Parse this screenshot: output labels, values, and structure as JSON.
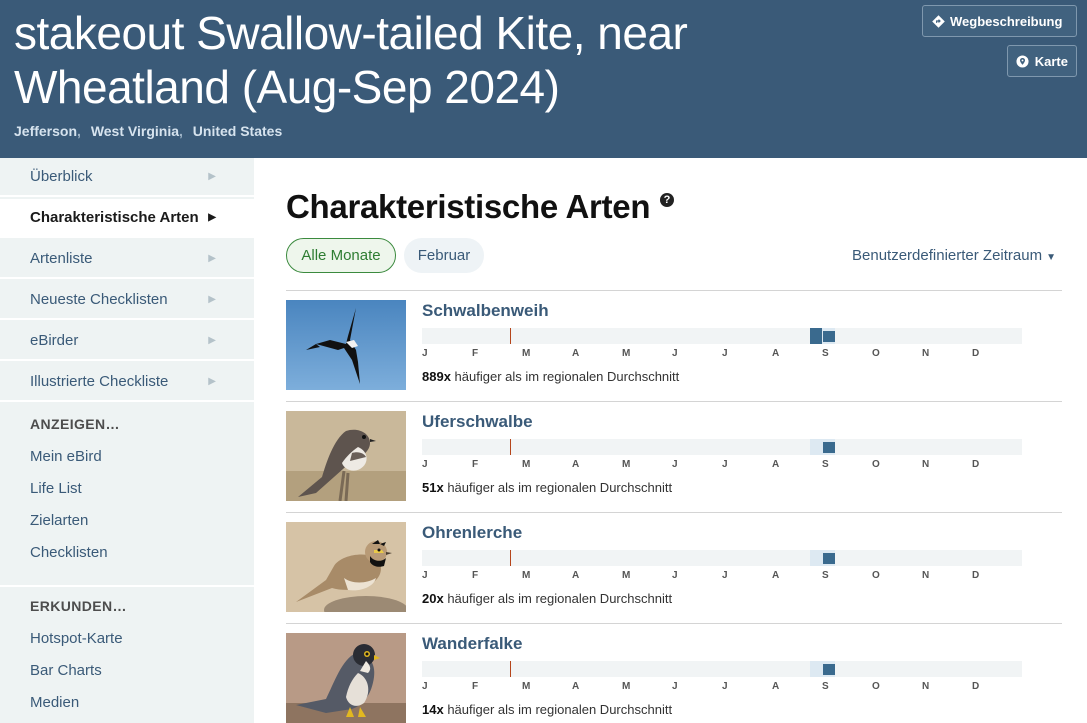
{
  "header": {
    "title_line1": "stakeout Swallow-tailed Kite, near",
    "title_line2": "Wheatland (Aug-Sep 2024)",
    "location": [
      "Jefferson",
      "West Virginia",
      "United States"
    ],
    "directions_label": "Wegbeschreibung",
    "map_label": "Karte"
  },
  "sidebar": {
    "items": [
      {
        "label": "Überblick",
        "active": false
      },
      {
        "label": "Charakteristische Arten",
        "active": true
      },
      {
        "label": "Artenliste",
        "active": false
      },
      {
        "label": "Neueste Checklisten",
        "active": false
      },
      {
        "label": "eBirder",
        "active": false
      },
      {
        "label": "Illustrierte Checkliste",
        "active": false
      }
    ],
    "view_heading": "ANZEIGEN…",
    "view_links": [
      "Mein eBird",
      "Life List",
      "Zielarten",
      "Checklisten"
    ],
    "explore_heading": "ERKUNDEN…",
    "explore_links": [
      "Hotspot-Karte",
      "Bar Charts",
      "Medien"
    ]
  },
  "main": {
    "title": "Charakteristische Arten",
    "help_glyph": "?",
    "filters": {
      "all_months": "Alle Monate",
      "february": "Februar"
    },
    "custom_range": "Benutzerdefinierter Zeitraum",
    "months": [
      "J",
      "F",
      "M",
      "A",
      "M",
      "J",
      "J",
      "A",
      "S",
      "O",
      "N",
      "D"
    ],
    "stat_suffix": "häufiger als im regionalen Durchschnitt",
    "species": [
      {
        "name": "Schwalbenweih",
        "factor": "889x",
        "frequency": "high"
      },
      {
        "name": "Uferschwalbe",
        "factor": "51x",
        "frequency": "low"
      },
      {
        "name": "Ohrenlerche",
        "factor": "20x",
        "frequency": "low"
      },
      {
        "name": "Wanderfalke",
        "factor": "14x",
        "frequency": "low"
      }
    ]
  }
}
